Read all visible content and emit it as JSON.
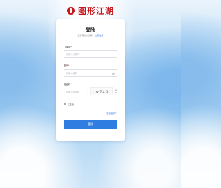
{
  "brand": {
    "name": "图形江湖",
    "color": "#c8161d",
    "icon": "logo-mark"
  },
  "form": {
    "title": "登陆",
    "subtitle_prefix": "还没有加入江湖？",
    "register_link": "立即注册",
    "account_label": "江湖ID",
    "account_placeholder": "请输入江湖ID",
    "password_label": "密码",
    "password_placeholder": "请输入密码",
    "captcha_label": "验证码",
    "captcha_placeholder": "请输入验证码",
    "captcha_text": "w7a6",
    "remember_label": "记住我",
    "forgot_link": "忘记密码？",
    "submit_label": "登陆",
    "required_mark": "*",
    "accent": "#2f7de1"
  }
}
